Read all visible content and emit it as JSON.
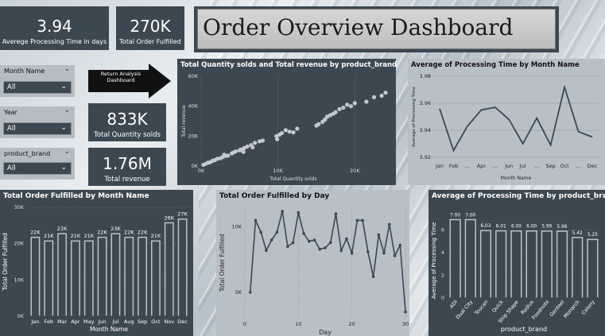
{
  "dashboard_title": "Order Overview Dashboard",
  "kpis": {
    "avg_processing": {
      "value": "3.94",
      "label": "Averege Processing Time in days"
    },
    "orders_fulfilled": {
      "value": "270K",
      "label": "Total Order Fulfilled"
    },
    "quantity": {
      "value": "833K",
      "label": "Total Quantity solds"
    },
    "revenue": {
      "value": "1.76M",
      "label": "Total revenue"
    }
  },
  "slicers": {
    "month": {
      "label": "Month Name",
      "value": "All"
    },
    "year": {
      "label": "Year",
      "value": "All"
    },
    "brand": {
      "label": "product_brand",
      "value": "All"
    }
  },
  "nav_button": {
    "line1": "Return Analysis",
    "line2": "Dashboard"
  },
  "colors": {
    "card_bg": "#3b4852",
    "light_card_bg": "#b8c0c7",
    "bar_fill": "#3b4852",
    "bar_fill_light": "#b9c5cc",
    "line": "#3b4852"
  },
  "chart_data": [
    {
      "id": "scatter",
      "type": "scatter",
      "title": "Total Quantity solds and Total revenue by product_brand",
      "xlabel": "Total Quantity solds",
      "ylabel": "Total revenue",
      "xlim": [
        0,
        24000
      ],
      "ylim": [
        0,
        60000
      ],
      "xticks": [
        "0K",
        "10K",
        "20K"
      ],
      "yticks": [
        "0K",
        "20K",
        "40K",
        "60K"
      ],
      "points": [
        [
          300,
          800
        ],
        [
          600,
          1500
        ],
        [
          900,
          2200
        ],
        [
          1200,
          2600
        ],
        [
          1500,
          3500
        ],
        [
          1800,
          4000
        ],
        [
          2100,
          4800
        ],
        [
          2500,
          5200
        ],
        [
          2800,
          6000
        ],
        [
          3200,
          6800
        ],
        [
          3500,
          7000
        ],
        [
          4000,
          8500
        ],
        [
          4200,
          9000
        ],
        [
          4500,
          9800
        ],
        [
          5000,
          10500
        ],
        [
          5200,
          11000
        ],
        [
          5600,
          12000
        ],
        [
          6000,
          13000
        ],
        [
          6500,
          14000
        ],
        [
          7000,
          15500
        ],
        [
          7600,
          16500
        ],
        [
          8000,
          17000
        ],
        [
          9800,
          20000
        ],
        [
          10200,
          21000
        ],
        [
          10500,
          22000
        ],
        [
          11000,
          24000
        ],
        [
          11500,
          23000
        ],
        [
          12000,
          22500
        ],
        [
          12500,
          25000
        ],
        [
          9900,
          18000
        ],
        [
          15000,
          27000
        ],
        [
          15300,
          28000
        ],
        [
          15800,
          29500
        ],
        [
          16100,
          31000
        ],
        [
          16400,
          33000
        ],
        [
          16800,
          34000
        ],
        [
          17200,
          35000
        ],
        [
          17500,
          36000
        ],
        [
          18000,
          38000
        ],
        [
          18500,
          39000
        ],
        [
          19000,
          41000
        ],
        [
          19500,
          40000
        ],
        [
          20000,
          42000
        ],
        [
          21500,
          43000
        ],
        [
          22500,
          46000
        ],
        [
          23500,
          47000
        ],
        [
          24000,
          49000
        ],
        [
          6700,
          12500
        ],
        [
          3000,
          7500
        ],
        [
          5500,
          9500
        ]
      ]
    },
    {
      "id": "month_line",
      "type": "line",
      "title": "Average of Processing Time by Month Name",
      "xlabel": "Month Name",
      "ylabel": "Average of Processing Time",
      "ylim": [
        3.92,
        3.98
      ],
      "yticks": [
        "3.92",
        "3.94",
        "3.96",
        "3.98"
      ],
      "categories": [
        "Jan",
        "Feb",
        "Mar",
        "Apr",
        "May",
        "Jun",
        "Jul",
        "Aug",
        "Sep",
        "Oct",
        "Nov",
        "Dec"
      ],
      "tick_labels": [
        "Jan",
        "Feb",
        "...",
        "Apr",
        "...",
        "Jun",
        "Jul",
        "...",
        "Sep",
        "Oct",
        "...",
        "Dec"
      ],
      "values": [
        3.956,
        3.925,
        3.943,
        3.955,
        3.957,
        3.948,
        3.93,
        3.949,
        3.929,
        3.972,
        3.939,
        3.935
      ]
    },
    {
      "id": "month_bar",
      "type": "bar",
      "title": "Total Order Fulfilled by Month Name",
      "xlabel": "Month Name",
      "ylabel": "Total Order Fulfilled",
      "ylim": [
        0,
        30000
      ],
      "yticks": [
        "0K",
        "10K",
        "20K",
        "30K"
      ],
      "categories": [
        "Jan",
        "Feb",
        "Mar",
        "Apr",
        "May",
        "Jun",
        "Jul",
        "Aug",
        "Sep",
        "Oct",
        "Nov",
        "Dec"
      ],
      "values": [
        22000,
        21000,
        23000,
        21000,
        21000,
        22000,
        23000,
        22000,
        22000,
        21000,
        26000,
        27000
      ],
      "labels": [
        "22K",
        "21K",
        "23K",
        "21K",
        "21K",
        "22K",
        "23K",
        "22K",
        "22K",
        "21K",
        "26K",
        "27K"
      ]
    },
    {
      "id": "day_line",
      "type": "line",
      "title": "Total Order Fulfilled by Day",
      "xlabel": "Day",
      "ylabel": "Total Order Fulfilled",
      "xlim": [
        0,
        30
      ],
      "ylim": [
        3000,
        11500
      ],
      "xticks": [
        "0",
        "10",
        "20",
        "30"
      ],
      "yticks": [
        "5K",
        "10K"
      ],
      "x": [
        1,
        2,
        3,
        4,
        5,
        6,
        7,
        8,
        9,
        10,
        11,
        12,
        13,
        14,
        15,
        16,
        17,
        18,
        19,
        20,
        21,
        22,
        23,
        24,
        25,
        26,
        27,
        28,
        29,
        30
      ],
      "values": [
        5000,
        10500,
        9600,
        8200,
        9000,
        9600,
        11200,
        8500,
        8800,
        11100,
        9500,
        8900,
        9000,
        8300,
        8400,
        8800,
        11000,
        8200,
        9100,
        8000,
        10500,
        10500,
        8100,
        6200,
        9400,
        8000,
        10200,
        7800,
        8600,
        3500
      ]
    },
    {
      "id": "brand_bar",
      "type": "bar",
      "title": "Average of Processing Time by product_brand",
      "xlabel": "product_brand",
      "ylabel": "Average of Processing Time",
      "ylim": [
        0,
        8
      ],
      "yticks": [
        "0",
        "2",
        "4",
        "6"
      ],
      "categories": [
        "ADI",
        "Dual City",
        "Toucan",
        "Quick",
        "Ship Shape",
        "Radius",
        "Foodnote",
        "Genteel",
        "Monarch",
        "Colony"
      ],
      "values": [
        7.0,
        7.0,
        6.03,
        6.01,
        6.0,
        6.0,
        5.99,
        5.98,
        5.42,
        5.25
      ],
      "labels": [
        "7.00",
        "7.00",
        "6.03",
        "6.01",
        "6.00",
        "6.00",
        "5.99",
        "5.98",
        "5.42",
        "5.25"
      ]
    }
  ]
}
